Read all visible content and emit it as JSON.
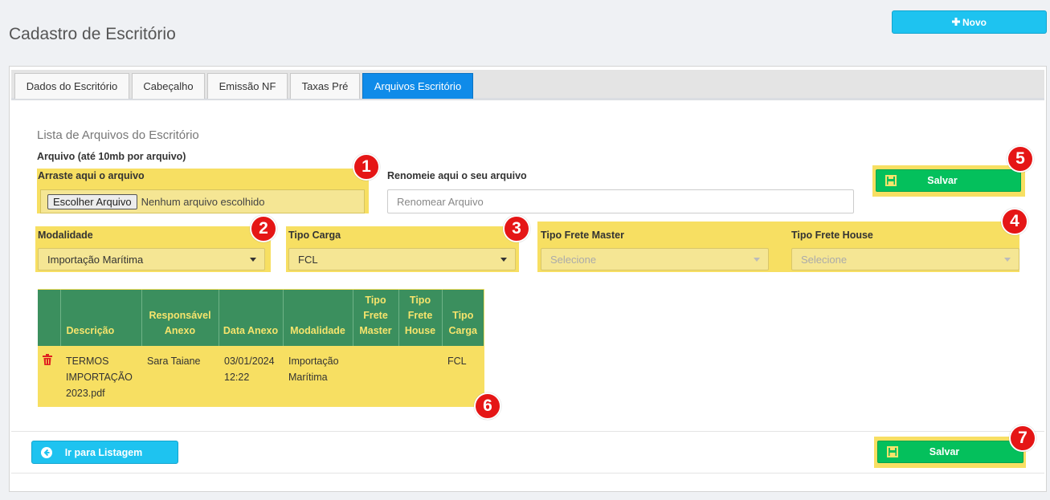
{
  "header": {
    "title": "Cadastro de Escritório",
    "new_button": "Novo"
  },
  "tabs": [
    {
      "label": "Dados do Escritório",
      "active": false
    },
    {
      "label": "Cabeçalho",
      "active": false
    },
    {
      "label": "Emissão NF",
      "active": false
    },
    {
      "label": "Taxas Pré",
      "active": false
    },
    {
      "label": "Arquivos Escritório",
      "active": true
    }
  ],
  "form": {
    "list_heading": "Lista de Arquivos do Escritório",
    "file_label": "Arquivo (até 10mb por arquivo)",
    "drop_label": "Arraste aqui o arquivo",
    "choose_button": "Escolher Arquivo",
    "file_status": "Nenhum arquivo escolhido",
    "rename_label": "Renomeie aqui o seu arquivo",
    "rename_placeholder": "Renomear Arquivo",
    "save_label": "Salvar",
    "modalidade": {
      "label": "Modalidade",
      "value": "Importação Marítima"
    },
    "tipo_carga": {
      "label": "Tipo Carga",
      "value": "FCL"
    },
    "tipo_frete_master": {
      "label": "Tipo Frete Master",
      "value": "Selecione"
    },
    "tipo_frete_house": {
      "label": "Tipo Frete House",
      "value": "Selecione"
    }
  },
  "table": {
    "headers": {
      "descricao": "Descrição",
      "responsavel": "Responsável Anexo",
      "data": "Data Anexo",
      "modalidade": "Modalidade",
      "frete_master": "Tipo Frete Master",
      "frete_house": "Tipo Frete House",
      "carga": "Tipo Carga"
    },
    "rows": [
      {
        "descricao": "TERMOS IMPORTAÇÃO 2023.pdf",
        "responsavel": "Sara Taiane",
        "data": "03/01/2024 12:22",
        "modalidade": "Importação Marítima",
        "frete_master": "",
        "frete_house": "",
        "carga": "FCL"
      }
    ]
  },
  "footer": {
    "back_button": "Ir para Listagem",
    "save_label": "Salvar"
  },
  "markers": [
    "1",
    "2",
    "3",
    "4",
    "5",
    "6",
    "7"
  ],
  "colors": {
    "accent_blue": "#1ec3f0",
    "tab_active": "#0f8be9",
    "save_green": "#04c05c",
    "table_header": "#3b8f5e",
    "highlight_yellow": "#f7df62",
    "marker_red": "#e51616"
  }
}
